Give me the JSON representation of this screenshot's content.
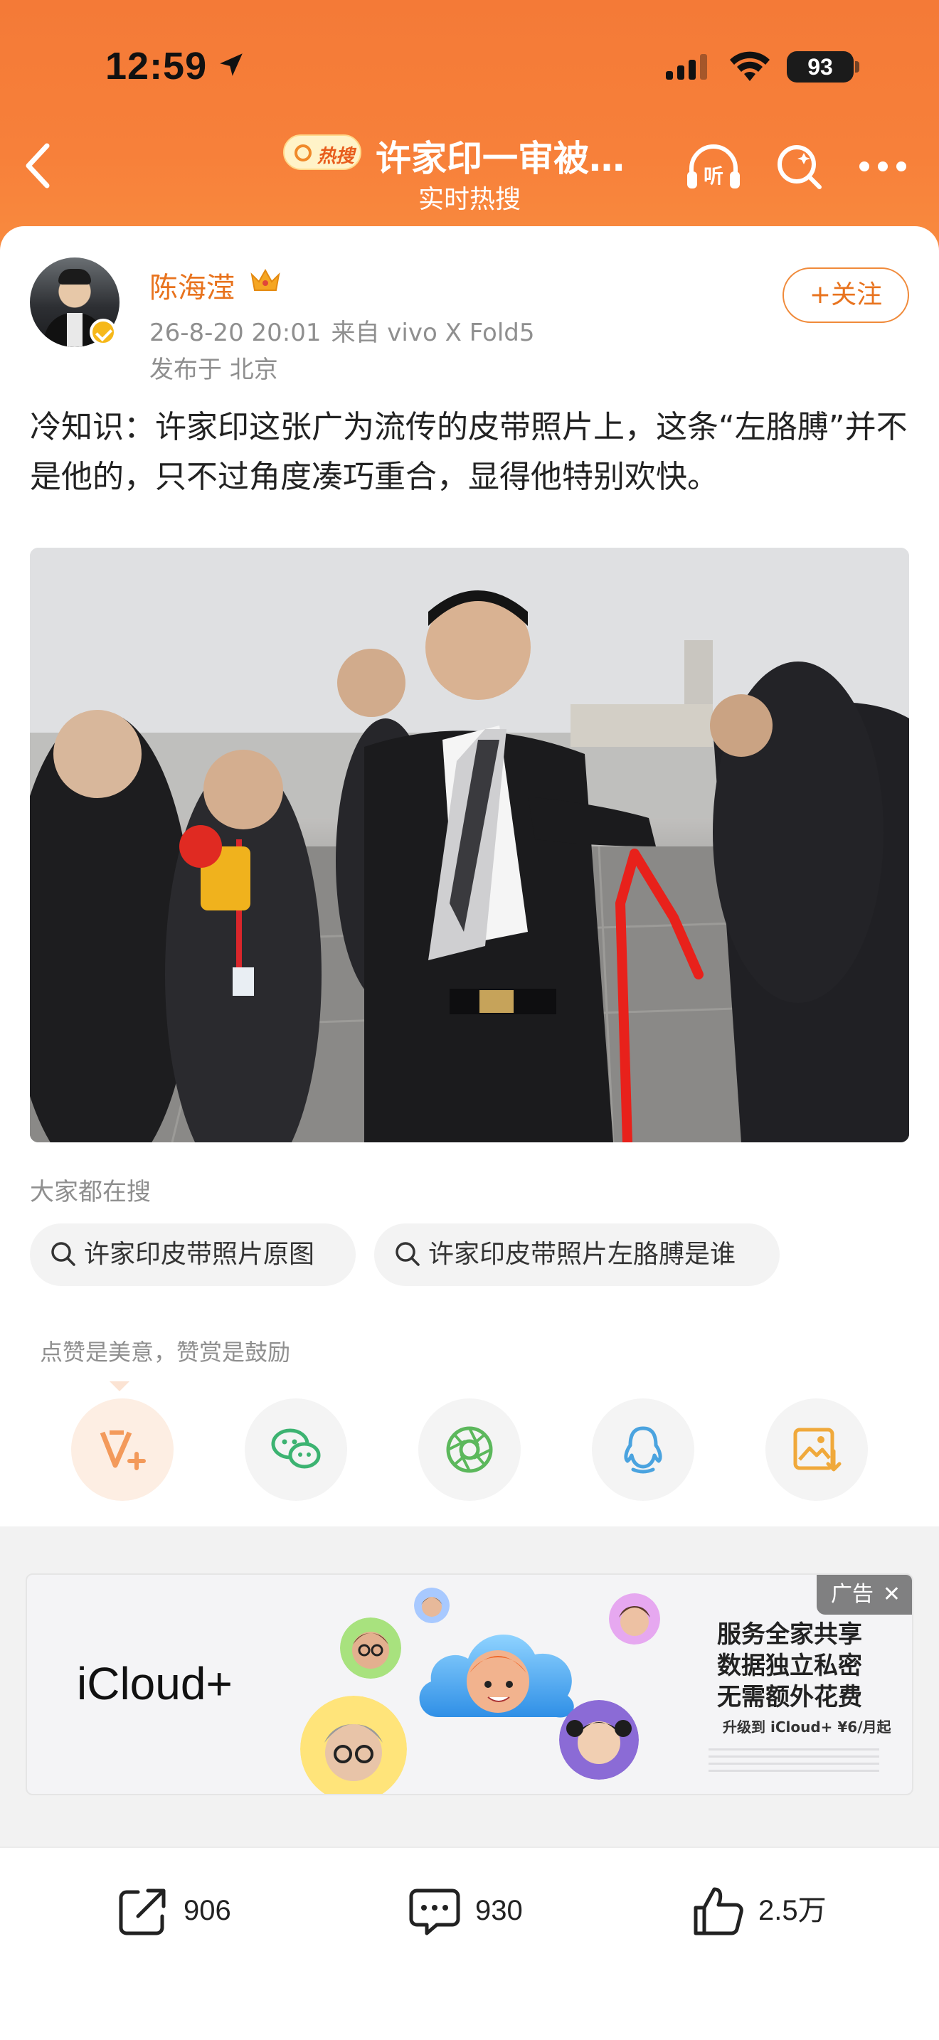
{
  "status_bar": {
    "time": "12:59",
    "battery": "93"
  },
  "nav": {
    "hot_badge": "热搜",
    "title": "许家印一审被…",
    "subtitle": "实时热搜"
  },
  "post": {
    "author": "陈海滢",
    "timestamp": "26-8-20 20:01",
    "source": "来自 vivo X Fold5",
    "location": "发布于 北京",
    "follow_label": "+关注",
    "text": "冷知识：许家印这张广为流传的皮带照片上，这条“左胳膊”并不是他的，只不过角度凑巧重合，显得他特别欢快。"
  },
  "related": {
    "label": "大家都在搜",
    "chips": [
      "许家印皮带照片原图",
      "许家印皮带照片左胳膊是谁"
    ]
  },
  "reward": {
    "label": "点赞是美意，赞赏是鼓励"
  },
  "share_icons": [
    "reward-v-icon",
    "wechat-icon",
    "moments-icon",
    "qq-icon",
    "save-image-icon"
  ],
  "ad": {
    "tag": "广告",
    "brand": "iCloud+",
    "line1": "服务全家共享",
    "line2": "数据独立私密",
    "line3": "无需额外花费",
    "line4": "升级到 iCloud+ ¥6/月起"
  },
  "actions": {
    "reposts": "906",
    "comments": "930",
    "likes": "2.5万"
  },
  "colors": {
    "header": "#f47a37",
    "accent": "#e8731e",
    "photo_arrow": "#e8211b"
  }
}
